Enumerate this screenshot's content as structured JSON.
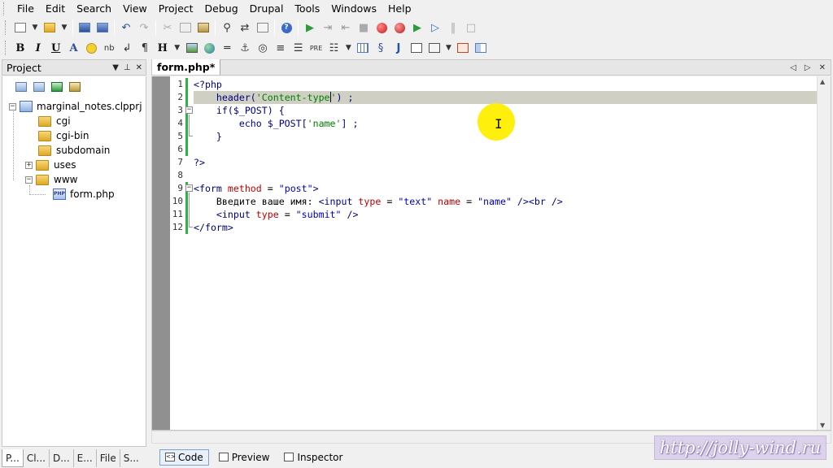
{
  "menu": [
    "File",
    "Edit",
    "Search",
    "View",
    "Project",
    "Debug",
    "Drupal",
    "Tools",
    "Windows",
    "Help"
  ],
  "toolbar1_icons": [
    "new-file-icon",
    "open-file-icon",
    "save-icon",
    "save-all-icon",
    "undo-icon",
    "redo-icon",
    "cut-icon",
    "copy-icon",
    "paste-icon",
    "find-icon",
    "find-replace-icon",
    "find-in-files-icon",
    "help-icon",
    "run-icon",
    "step-icon",
    "step-out-icon",
    "stop-icon",
    "record-icon",
    "breakpoint-icon",
    "play-icon",
    "play-outline-icon",
    "pause-icon",
    "square-icon"
  ],
  "toolbar2": {
    "bold": "B",
    "italic": "I",
    "underline": "U",
    "font": "A",
    "nbsp": "nb",
    "br": "↲",
    "para": "¶",
    "heading": "H",
    "pre": "PRE",
    "j": "J"
  },
  "project_panel": {
    "title": "Project",
    "tree": {
      "root": "marginal_notes.clpprj",
      "items": [
        "cgi",
        "cgi-bin",
        "subdomain",
        "uses",
        "www"
      ],
      "www_child": "form.php",
      "php_badge": "PHP"
    },
    "bottom_tabs": [
      "P...",
      "Cl...",
      "D...",
      "E...",
      "File",
      "S..."
    ]
  },
  "editor": {
    "tab_title": "form.php*",
    "line_numbers": [
      "1",
      "2",
      "3",
      "4",
      "5",
      "6",
      "7",
      "8",
      "9",
      "10",
      "11",
      "12"
    ],
    "code": {
      "l1": "<?php",
      "l2_fn": "header(",
      "l2_str1": "'Content-type",
      "l2_str2": "'",
      "l2_end": ") ;",
      "l3": "if($_POST) {",
      "l4_kw": "echo",
      "l4_rest": " $_POST[",
      "l4_str": "'name'",
      "l4_end": "] ;",
      "l5": "}",
      "l7": "?>",
      "l9_tag": "<form",
      "l9_attr": " method",
      "l9_eq": " = ",
      "l9_val": "\"post\"",
      "l9_close": ">",
      "l10_text": "Введите ваше имя: ",
      "l10_tag": "<input",
      "l10_a1": " type",
      "l10_eq": " = ",
      "l10_v1": "\"text\"",
      "l10_a2": " name",
      "l10_v2": "\"name\"",
      "l10_close": " /><br />",
      "l11_tag": "<input",
      "l11_a1": " type",
      "l11_eq": " = ",
      "l11_v1": "\"submit\"",
      "l11_close": " />",
      "l12": "</form>"
    }
  },
  "view_tabs": [
    "Code",
    "Preview",
    "Inspector"
  ],
  "watermark": "http://jolly-wind.ru",
  "colors": {
    "highlight_line": "#cfcfc4",
    "string": "#008000",
    "attribute": "#c00000",
    "attr_value": "#0000c0",
    "keyword": "#000080",
    "cursor_halo": "#ffee00"
  }
}
